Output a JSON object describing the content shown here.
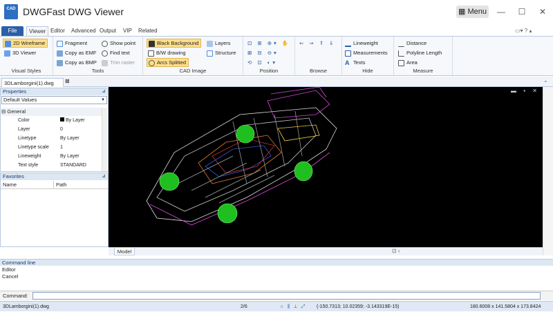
{
  "app": {
    "title": "DWGFast DWG Viewer",
    "logo_text": "CAD",
    "menu_label": "Menu"
  },
  "window_controls": {
    "minimize": "—",
    "maximize": "☐",
    "close": "✕"
  },
  "ribbon_tabs": [
    "File",
    "Viewer",
    "Editor",
    "Advanced",
    "Output",
    "VIP",
    "Related"
  ],
  "ribbon": {
    "visual_styles": {
      "label": "Visual Styles",
      "items": [
        "2D Wireframe",
        "3D Viewer"
      ]
    },
    "tools": {
      "label": "Tools",
      "items": [
        "Fragment",
        "Copy as EMF",
        "Copy as BMP",
        "Show point",
        "Find text",
        "Trim raster"
      ]
    },
    "cad_image": {
      "label": "CAD Image",
      "items": [
        "Black Background",
        "B/W drawing",
        "Arcs Splitted",
        "Layers",
        "Structure"
      ]
    },
    "position": {
      "label": "Position"
    },
    "browse": {
      "label": "Browse"
    },
    "hide": {
      "label": "Hide",
      "items": [
        "Lineweight",
        "Measurements",
        "Texts"
      ]
    },
    "measure": {
      "label": "Measure",
      "items": [
        "Distance",
        "Polyline Length",
        "Area"
      ]
    }
  },
  "document_tab": "3DLamborgini(1).dwg",
  "properties": {
    "title": "Properties",
    "selector": "Default Values",
    "group": "General",
    "rows": [
      {
        "name": "Color",
        "value": "By Layer"
      },
      {
        "name": "Layer",
        "value": "0"
      },
      {
        "name": "Linetype",
        "value": "By Layer"
      },
      {
        "name": "Linetype scale",
        "value": "1"
      },
      {
        "name": "Lineweight",
        "value": "By Layer"
      },
      {
        "name": "Text style",
        "value": "STANDARD"
      }
    ]
  },
  "favorites": {
    "title": "Favorites",
    "columns": [
      "Name",
      "Path"
    ]
  },
  "model_tab": "Model",
  "command": {
    "header": "Command line",
    "log": [
      "Editor",
      "Cancel"
    ],
    "prompt": "Command:"
  },
  "status": {
    "file": "3DLamborgini(1).dwg",
    "page": "2/6",
    "coords": "(-150.7313; 10.02359; -3.143319E-15)",
    "size": "180.6008 x 141.5804 x 173.8424"
  },
  "colors": {
    "accent": "#2b5fa8",
    "selected": "#fddf8c",
    "canvas": "#000000"
  }
}
